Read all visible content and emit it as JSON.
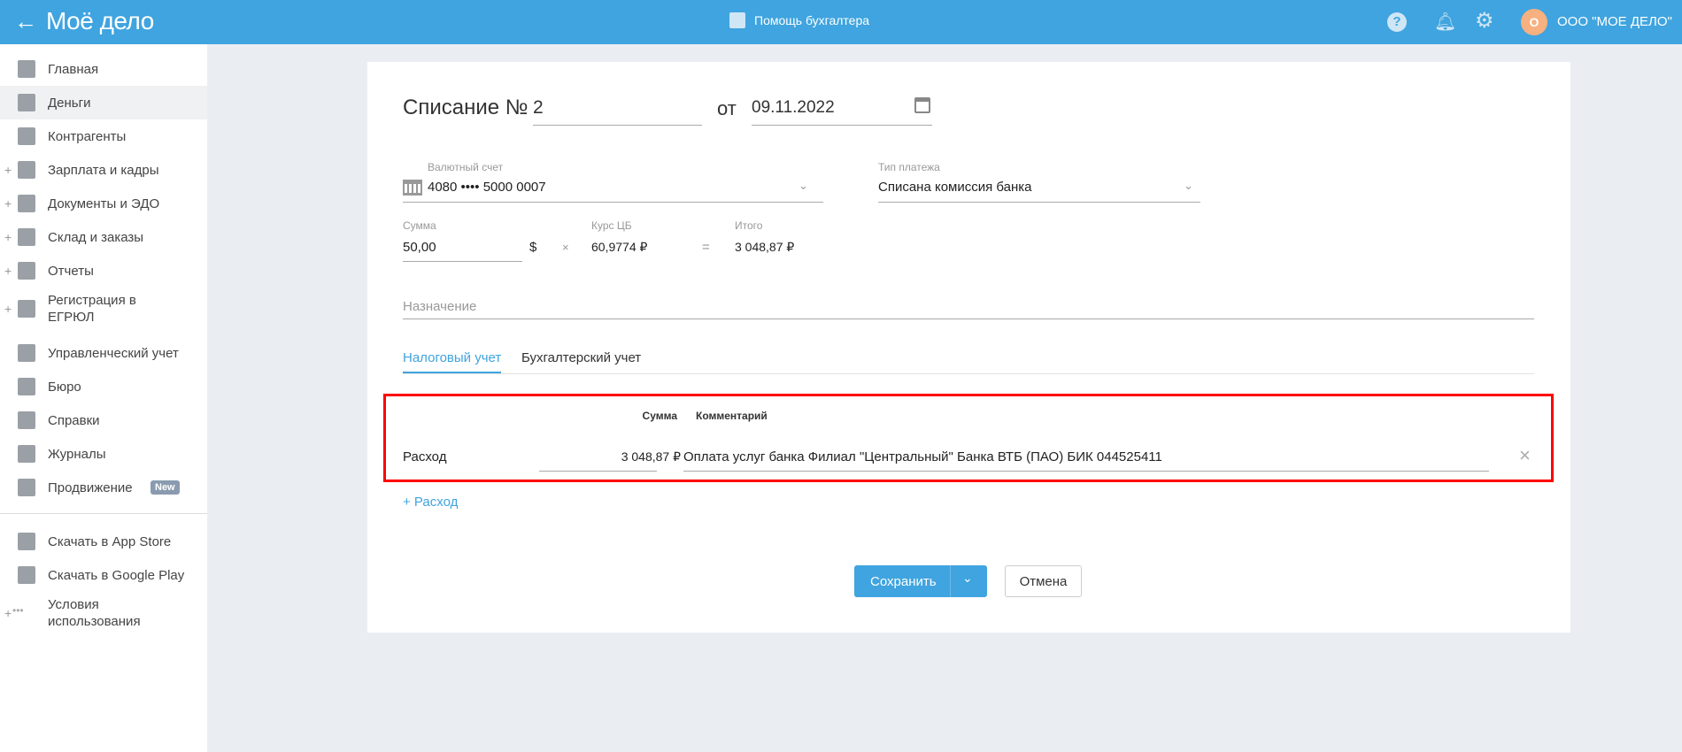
{
  "header": {
    "logo": "Моё дело",
    "help_link": "Помощь бухгалтера",
    "avatar_letter": "О",
    "company": "ООО \"МОЕ ДЕЛО\""
  },
  "sidebar": {
    "items": [
      {
        "label": "Главная",
        "plus": false,
        "icon": "home-icon"
      },
      {
        "label": "Деньги",
        "plus": false,
        "icon": "money-icon",
        "active": true
      },
      {
        "label": "Контрагенты",
        "plus": false,
        "icon": "contractor-icon"
      },
      {
        "label": "Зарплата и кадры",
        "plus": true,
        "icon": "salary-icon"
      },
      {
        "label": "Документы и ЭДО",
        "plus": true,
        "icon": "documents-icon"
      },
      {
        "label": "Склад и заказы",
        "plus": true,
        "icon": "warehouse-icon"
      },
      {
        "label": "Отчеты",
        "plus": true,
        "icon": "reports-icon"
      },
      {
        "label": "Регистрация в ЕГРЮЛ",
        "plus": true,
        "icon": "registration-icon"
      },
      {
        "label": "Управленческий учет",
        "plus": false,
        "icon": "management-icon"
      },
      {
        "label": "Бюро",
        "plus": false,
        "icon": "briefcase-icon"
      },
      {
        "label": "Справки",
        "plus": false,
        "icon": "reference-icon"
      },
      {
        "label": "Журналы",
        "plus": false,
        "icon": "journal-icon"
      },
      {
        "label": "Продвижение",
        "plus": false,
        "icon": "promo-icon",
        "badge": "New"
      }
    ],
    "bottom": [
      {
        "label": "Скачать в App Store",
        "icon": "apple-icon"
      },
      {
        "label": "Скачать в Google Play",
        "icon": "google-play-icon"
      },
      {
        "label": "Условия использования",
        "icon": "more-icon",
        "plus": true
      }
    ]
  },
  "form": {
    "title": "Списание №",
    "number": "2",
    "from_label": "от",
    "date": "09.11.2022",
    "account_label": "Валютный счет",
    "account_value": "4080 •••• 5000 0007",
    "payment_type_label": "Тип платежа",
    "payment_type_value": "Списана комиссия банка",
    "sum_label": "Сумма",
    "sum_value": "50,00",
    "currency": "$",
    "times": "×",
    "rate_label": "Курс ЦБ",
    "rate_value": "60,9774 ₽",
    "equals": "=",
    "total_label": "Итого",
    "total_value": "3 048,87 ₽",
    "purpose_placeholder": "Назначение",
    "tabs": [
      "Налоговый учет",
      "Бухгалтерский учет"
    ],
    "table": {
      "col_sum": "Сумма",
      "col_comment": "Комментарий",
      "row": {
        "type": "Расход",
        "sum": "3 048,87 ₽",
        "comment": "Оплата услуг банка Филиал \"Центральный\" Банка ВТБ (ПАО) БИК 044525411"
      }
    },
    "add_expense": "+ Расход",
    "save": "Сохранить",
    "cancel": "Отмена"
  },
  "colors": {
    "header": "#3fa4df",
    "accent": "#3fa4df",
    "avatar": "#f7b07f"
  }
}
